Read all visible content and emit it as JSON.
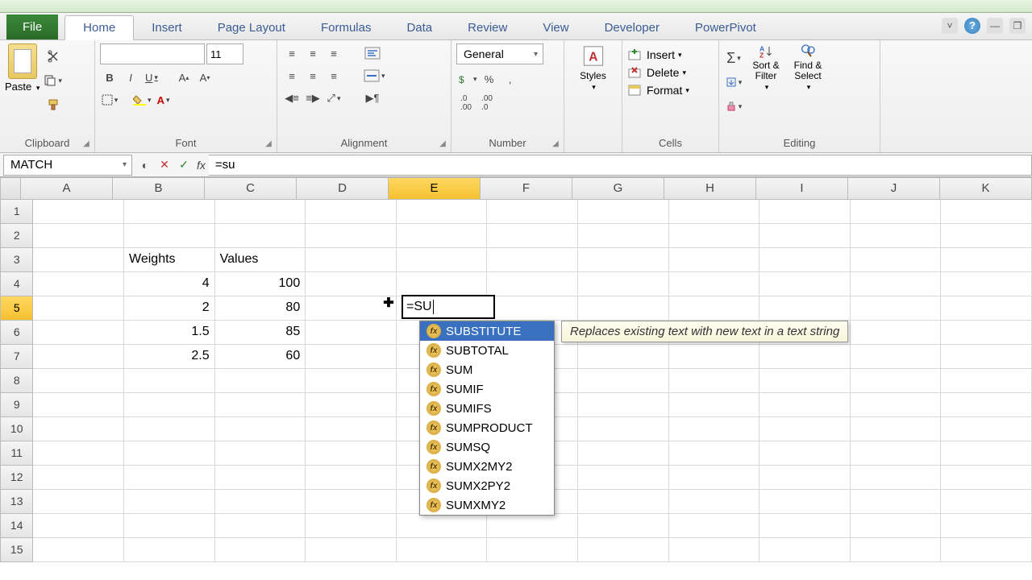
{
  "tabs": {
    "file": "File",
    "list": [
      "Home",
      "Insert",
      "Page Layout",
      "Formulas",
      "Data",
      "Review",
      "View",
      "Developer",
      "PowerPivot"
    ],
    "active": 0
  },
  "ribbon": {
    "clipboard": {
      "label": "Clipboard",
      "paste": "Paste"
    },
    "font": {
      "label": "Font",
      "size": "11",
      "bold": "B",
      "italic": "I",
      "underline": "U"
    },
    "alignment": {
      "label": "Alignment"
    },
    "number": {
      "label": "Number",
      "format": "General"
    },
    "styles": {
      "label": "Styles"
    },
    "cells": {
      "label": "Cells",
      "insert": "Insert",
      "delete": "Delete",
      "format": "Format"
    },
    "editing": {
      "label": "Editing",
      "sort": "Sort & Filter",
      "find": "Find & Select"
    }
  },
  "formula_bar": {
    "name_box": "MATCH",
    "formula": "=su"
  },
  "grid": {
    "columns": [
      "A",
      "B",
      "C",
      "D",
      "E",
      "F",
      "G",
      "H",
      "I",
      "J",
      "K"
    ],
    "active_col": "E",
    "active_row": 5,
    "rows": 15,
    "data": {
      "B3": {
        "v": "Weights",
        "t": "txt"
      },
      "C3": {
        "v": "Values",
        "t": "txt"
      },
      "B4": {
        "v": "4",
        "t": "num"
      },
      "C4": {
        "v": "100",
        "t": "num"
      },
      "B5": {
        "v": "2",
        "t": "num"
      },
      "C5": {
        "v": "80",
        "t": "num"
      },
      "B6": {
        "v": "1.5",
        "t": "num"
      },
      "C6": {
        "v": "85",
        "t": "num"
      },
      "B7": {
        "v": "2.5",
        "t": "num"
      },
      "C7": {
        "v": "60",
        "t": "num"
      }
    }
  },
  "edit": {
    "text": "=SU",
    "cell_ref": "E5"
  },
  "autocomplete": {
    "items": [
      "SUBSTITUTE",
      "SUBTOTAL",
      "SUM",
      "SUMIF",
      "SUMIFS",
      "SUMPRODUCT",
      "SUMSQ",
      "SUMX2MY2",
      "SUMX2PY2",
      "SUMXMY2"
    ],
    "selected": 0,
    "tooltip": "Replaces existing text with new text in a text string"
  }
}
